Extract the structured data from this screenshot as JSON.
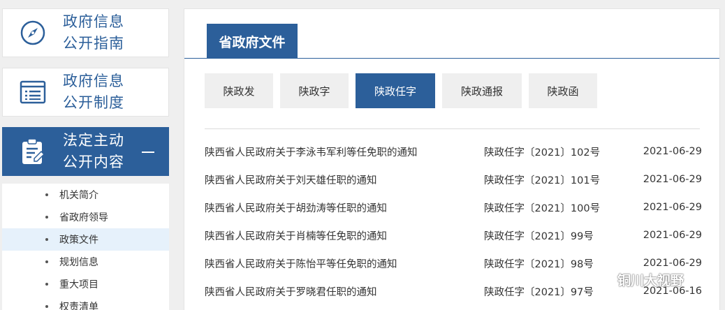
{
  "sidebar": {
    "cards": [
      {
        "line1": "政府信息",
        "line2": "公开指南",
        "icon": "compass-icon"
      },
      {
        "line1": "政府信息",
        "line2": "公开制度",
        "icon": "list-window-icon"
      },
      {
        "line1": "法定主动",
        "line2": "公开内容",
        "icon": "clipboard-edit-icon",
        "expanded": true
      }
    ],
    "subitems": [
      {
        "label": "机关简介"
      },
      {
        "label": "省政府领导"
      },
      {
        "label": "政策文件",
        "selected": true
      },
      {
        "label": "规划信息"
      },
      {
        "label": "重大项目"
      },
      {
        "label": "权责清单"
      }
    ]
  },
  "main": {
    "tab_label": "省政府文件",
    "filters": [
      "陕政发",
      "陕政字",
      "陕政任字",
      "陕政通报",
      "陕政函"
    ],
    "active_filter": "陕政任字",
    "rows": [
      {
        "title": "陕西省人民政府关于李泳韦军利等任免职的通知",
        "number": "陕政任字〔2021〕102号",
        "date": "2021-06-29"
      },
      {
        "title": "陕西省人民政府关于刘天雄任职的通知",
        "number": "陕政任字〔2021〕101号",
        "date": "2021-06-29"
      },
      {
        "title": "陕西省人民政府关于胡劲涛等任职的通知",
        "number": "陕政任字〔2021〕100号",
        "date": "2021-06-29"
      },
      {
        "title": "陕西省人民政府关于肖楠等任免职的通知",
        "number": "陕政任字〔2021〕99号",
        "date": "2021-06-29"
      },
      {
        "title": "陕西省人民政府关于陈怡平等任免职的通知",
        "number": "陕政任字〔2021〕98号",
        "date": "2021-06-29"
      },
      {
        "title": "陕西省人民政府关于罗晓君任职的通知",
        "number": "陕政任字〔2021〕97号",
        "date": "2021-06-16"
      }
    ]
  },
  "watermark": {
    "text": "铜川大视野",
    "icon": "wechat-icon"
  },
  "colors": {
    "primary": "#2c5f9a",
    "page_bg": "#efefef",
    "selected_bg": "#e6f1fb"
  }
}
